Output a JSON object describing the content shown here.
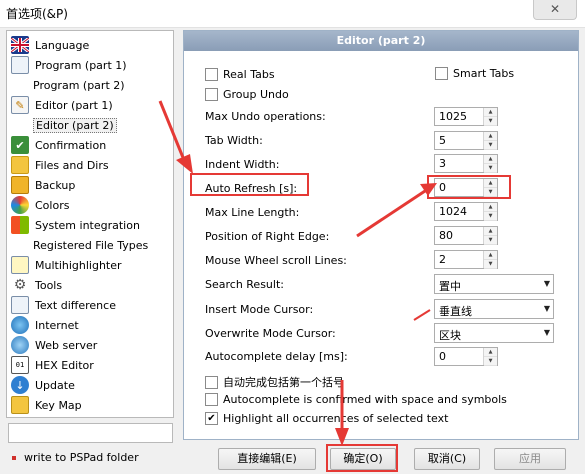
{
  "window": {
    "title": "首选项(&P)",
    "close_label": "✕"
  },
  "sidebar": {
    "items": [
      {
        "label": "Language",
        "icon": "uk-flag-icon",
        "child": false
      },
      {
        "label": "Program  (part 1)",
        "icon": "document-icon",
        "child": false
      },
      {
        "label": "Program  (part 2)",
        "icon": "",
        "child": true
      },
      {
        "label": "Editor  (part 1)",
        "icon": "edit-document-icon",
        "child": false
      },
      {
        "label": "Editor  (part 2)",
        "icon": "",
        "child": true,
        "selected": true
      },
      {
        "label": "Confirmation",
        "icon": "confirmation-icon",
        "child": false
      },
      {
        "label": "Files and Dirs",
        "icon": "folder-icon",
        "child": false
      },
      {
        "label": "Backup",
        "icon": "backup-icon",
        "child": false
      },
      {
        "label": "Colors",
        "icon": "colors-icon",
        "child": false
      },
      {
        "label": "System integration",
        "icon": "windows-icon",
        "child": false
      },
      {
        "label": "Registered File Types",
        "icon": "",
        "child": true
      },
      {
        "label": "Multihighlighter",
        "icon": "highlighter-icon",
        "child": false
      },
      {
        "label": "Tools",
        "icon": "gear-icon",
        "child": false
      },
      {
        "label": "Text difference",
        "icon": "text-diff-icon",
        "child": false
      },
      {
        "label": "Internet",
        "icon": "globe-icon",
        "child": false
      },
      {
        "label": "Web server",
        "icon": "web-server-icon",
        "child": false
      },
      {
        "label": "HEX Editor",
        "icon": "hex-icon",
        "child": false
      },
      {
        "label": "Update",
        "icon": "update-icon",
        "child": false
      },
      {
        "label": "Key Map",
        "icon": "keyboard-icon",
        "child": false
      }
    ],
    "pspad_folder_label": "write to PSPad folder"
  },
  "panel": {
    "title": "Editor  (part 2)",
    "real_tabs": {
      "label": "Real Tabs",
      "checked": false
    },
    "smart_tabs": {
      "label": "Smart Tabs",
      "checked": false
    },
    "group_undo": {
      "label": "Group Undo",
      "checked": false
    },
    "max_undo": {
      "label": "Max Undo operations:",
      "value": "1025"
    },
    "tab_width": {
      "label": "Tab Width:",
      "value": "5"
    },
    "indent_width": {
      "label": "Indent Width:",
      "value": "3"
    },
    "auto_refresh": {
      "label": "Auto Refresh [s]:",
      "value": "0"
    },
    "max_line_length": {
      "label": "Max Line Length:",
      "value": "1024"
    },
    "right_edge": {
      "label": "Position of Right Edge:",
      "value": "80"
    },
    "wheel_lines": {
      "label": "Mouse Wheel scroll Lines:",
      "value": "2"
    },
    "search_result": {
      "label": "Search Result:",
      "value": "置中"
    },
    "insert_cursor": {
      "label": "Insert Mode Cursor:",
      "value": "垂直线"
    },
    "overwrite_cursor": {
      "label": "Overwrite Mode Cursor:",
      "value": "区块"
    },
    "autocomplete_delay": {
      "label": "Autocomplete delay [ms]:",
      "value": "0"
    },
    "autocomplete_first": {
      "label": "自动完成包括第一个括号",
      "checked": false
    },
    "autocomplete_space": {
      "label": "Autocomplete is confirmed with space and symbols",
      "checked": false
    },
    "highlight_all": {
      "label": "Highlight all occurrences of selected text",
      "checked": true
    }
  },
  "buttons": {
    "direct_edit": "直接编辑(E)",
    "ok": "确定(O)",
    "cancel": "取消(C)",
    "apply": "应用"
  },
  "colors": {
    "annotation_red": "#e53935",
    "panel_header": "#8a9db6"
  }
}
